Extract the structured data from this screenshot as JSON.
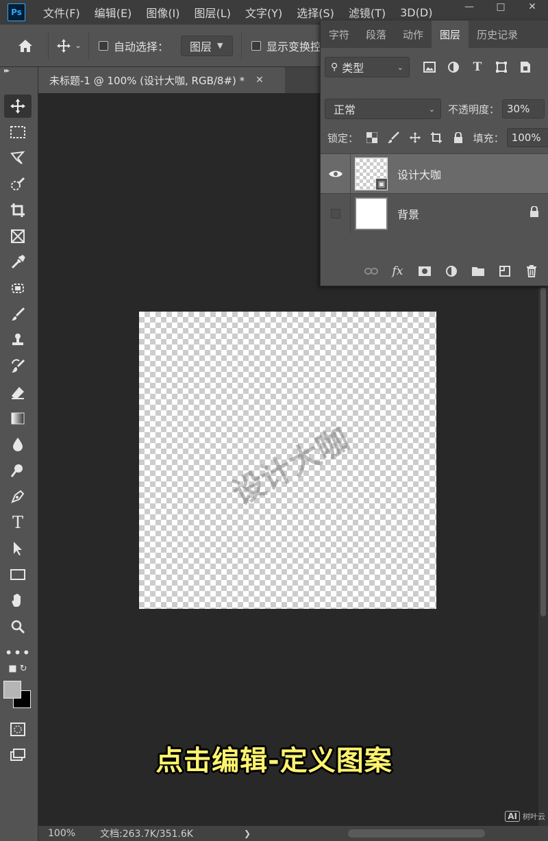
{
  "app": {
    "logo": "Ps",
    "menu": [
      "文件(F)",
      "编辑(E)",
      "图像(I)",
      "图层(L)",
      "文字(Y)",
      "选择(S)",
      "滤镜(T)",
      "3D(D)"
    ],
    "window_controls": [
      "minimize-icon",
      "restore-icon",
      "close-icon"
    ]
  },
  "options_bar": {
    "home_icon": "home-icon",
    "move_icon": "move-tool-icon",
    "auto_select_label": "自动选择：",
    "auto_select_checked": false,
    "auto_select_target": "图层",
    "show_transform_label": "显示变换控件",
    "show_transform_checked": false
  },
  "document": {
    "tab_title": "未标题-1 @ 100% (设计大咖, RGB/8#) *",
    "watermark_text": "设计大咖"
  },
  "toolbar": {
    "tools": [
      "move-tool-icon",
      "marquee-tool-icon",
      "lasso-tool-icon",
      "quick-select-tool-icon",
      "crop-tool-icon",
      "frame-tool-icon",
      "eyedropper-tool-icon",
      "patch-tool-icon",
      "brush-tool-icon",
      "stamp-tool-icon",
      "history-brush-tool-icon",
      "eraser-tool-icon",
      "gradient-tool-icon",
      "blur-tool-icon",
      "dodge-tool-icon",
      "pen-tool-icon",
      "type-tool-icon",
      "path-select-tool-icon",
      "rectangle-tool-icon",
      "hand-tool-icon",
      "zoom-tool-icon",
      "more-tools-icon"
    ],
    "foreground_color": "#b5b5b5",
    "background_color": "#000000"
  },
  "layers_panel": {
    "tabs": [
      "字符",
      "段落",
      "动作",
      "图层",
      "历史记录"
    ],
    "active_tab": "图层",
    "filter_kind": "类型",
    "blend_mode": "正常",
    "opacity_label": "不透明度：",
    "opacity_value": "30%",
    "lock_label": "锁定：",
    "fill_label": "填充：",
    "fill_value": "100%",
    "layers": [
      {
        "name": "设计大咖",
        "visible": true,
        "selected": true,
        "smart_object": true,
        "locked": false
      },
      {
        "name": "背景",
        "visible": false,
        "selected": false,
        "smart_object": false,
        "locked": true
      }
    ]
  },
  "status_bar": {
    "zoom": "100%",
    "doc_size": "文档:263.7K/351.6K"
  },
  "subtitle": "点击编辑-定义图案",
  "badge": {
    "logo": "AI",
    "text": "树叶云"
  }
}
